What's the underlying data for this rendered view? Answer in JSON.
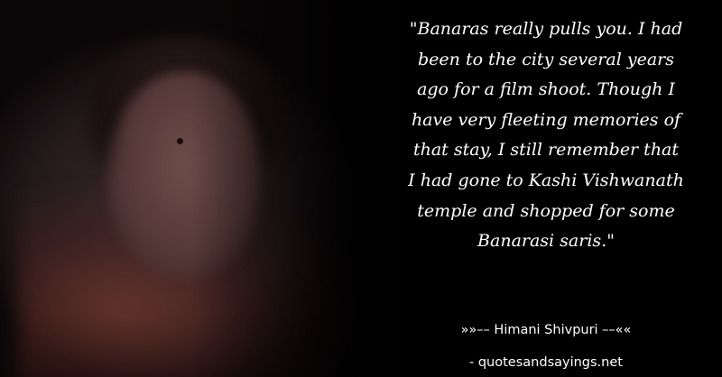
{
  "quote": {
    "text": "\"Banaras really pulls you. I had\nbeen to the city several years\nago for a film shoot. Though I\nhave very fleeting memories of\nthat stay, I still remember that\nI had gone to Kashi Vishwanath\ntemple and shopped for some\nBanarasi saris.\""
  },
  "author": {
    "line": "»»–– Himani Shivpuri ––««"
  },
  "watermark": {
    "text": "- quotesandsayings.net"
  },
  "colors": {
    "background": "#000000",
    "text": "#ffffff"
  }
}
